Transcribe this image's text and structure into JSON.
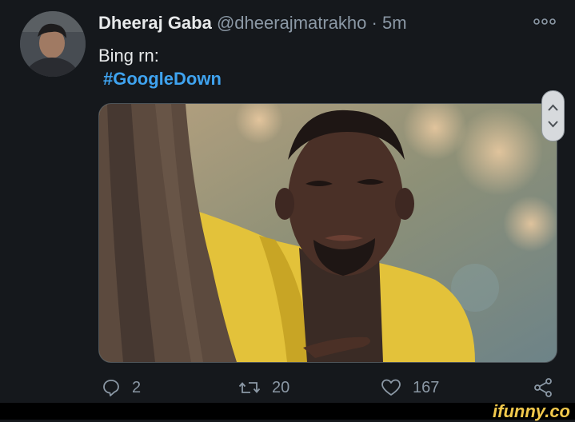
{
  "tweet": {
    "author_name": "Dheeraj Gaba",
    "handle": "@dheerajmatrakho",
    "separator": "·",
    "time": "5m",
    "text": "Bing rn:",
    "hashtag": "#GoogleDown"
  },
  "actions": {
    "reply_count": "2",
    "retweet_count": "20",
    "like_count": "167"
  },
  "watermark": "ifunny.co",
  "colors": {
    "background": "#15181c",
    "hashtag": "#3fa3ef",
    "muted": "#8b98a5",
    "watermark": "#f2c94c"
  },
  "icons": [
    "more-icon",
    "reply-icon",
    "retweet-icon",
    "like-icon",
    "share-icon",
    "chevron-up-icon",
    "chevron-down-icon"
  ]
}
